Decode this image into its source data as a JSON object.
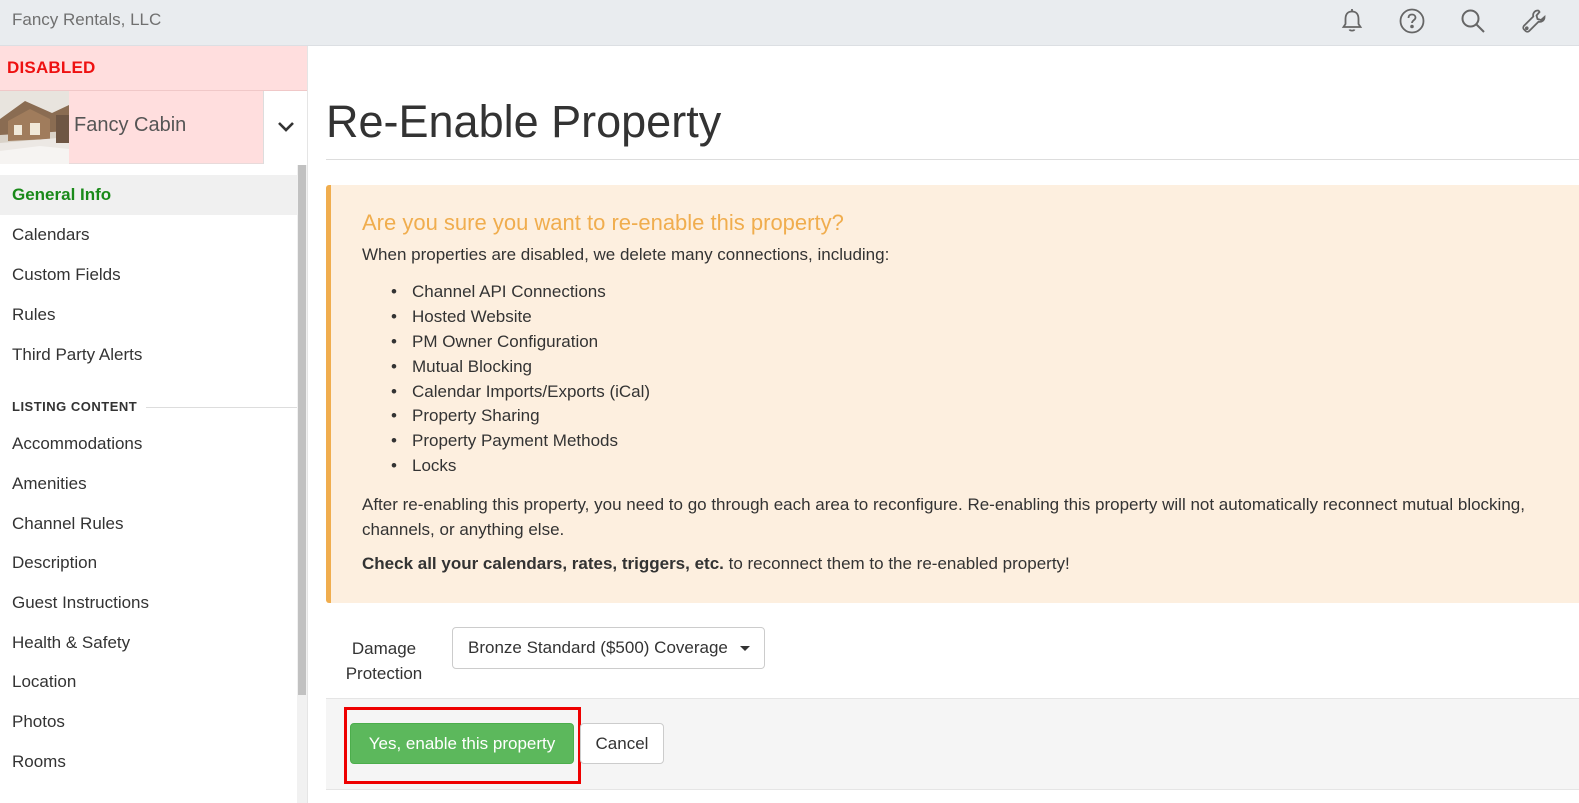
{
  "header": {
    "company": "Fancy Rentals, LLC",
    "icons": [
      "bell-icon",
      "help-icon",
      "search-icon",
      "wrench-icon"
    ]
  },
  "sidebar": {
    "status": "DISABLED",
    "property_name": "Fancy Cabin",
    "items": [
      {
        "label": "General Info",
        "active": true
      },
      {
        "label": "Calendars"
      },
      {
        "label": "Custom Fields"
      },
      {
        "label": "Rules"
      },
      {
        "label": "Third Party Alerts"
      }
    ],
    "section_title": "LISTING CONTENT",
    "content_items": [
      {
        "label": "Accommodations"
      },
      {
        "label": "Amenities"
      },
      {
        "label": "Channel Rules"
      },
      {
        "label": "Description"
      },
      {
        "label": "Guest Instructions"
      },
      {
        "label": "Health & Safety"
      },
      {
        "label": "Location"
      },
      {
        "label": "Photos"
      },
      {
        "label": "Rooms"
      }
    ]
  },
  "main": {
    "title": "Re-Enable Property",
    "warning": {
      "title": "Are you sure you want to re-enable this property?",
      "intro": "When properties are disabled, we delete many connections, including:",
      "items": [
        "Channel API Connections",
        "Hosted Website",
        "PM Owner Configuration",
        "Mutual Blocking",
        "Calendar Imports/Exports (iCal)",
        "Property Sharing",
        "Property Payment Methods",
        "Locks"
      ],
      "after": "After re-enabling this property, you need to go through each area to reconfigure. Re-enabling this property will not automatically reconnect mutual blocking, channels, or anything else.",
      "check_bold": "Check all your calendars, rates, triggers, etc.",
      "check_rest": " to reconnect them to the re-enabled property!"
    },
    "damage_protection": {
      "label": "Damage Protection",
      "selected": "Bronze Standard ($500) Coverage"
    },
    "buttons": {
      "confirm": "Yes, enable this property",
      "cancel": "Cancel"
    }
  },
  "colors": {
    "disabled_bg": "#ffdede",
    "disabled_text": "#ee1111",
    "active_nav": "#1a8a1a",
    "warning_bg": "#fdefdf",
    "warning_accent": "#f0ad4e",
    "success": "#5cb85c",
    "highlight": "#ee0000"
  }
}
